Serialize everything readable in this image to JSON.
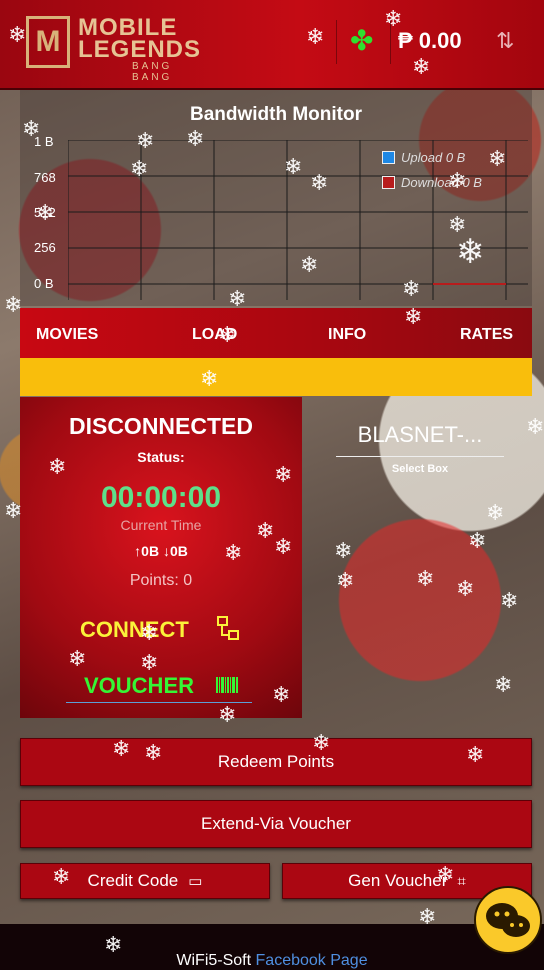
{
  "header": {
    "logo_mark": "M",
    "logo_line1": "MOBILE",
    "logo_line2": "LEGENDS",
    "logo_line3": "BANG BANG",
    "clover_icon": "clover-icon",
    "balance": "₱ 0.00",
    "sort_icon": "sort-icon"
  },
  "monitor": {
    "title": "Bandwidth Monitor",
    "y_ticks": [
      "1 B",
      "768",
      "512",
      "256",
      "0 B"
    ],
    "legend": [
      {
        "label": "Upload",
        "value": "0 B",
        "color": "#1e88e5"
      },
      {
        "label": "Download",
        "value": "0 B",
        "color": "#b71c1c"
      }
    ]
  },
  "nav": {
    "items": [
      "MOVIES",
      "LOAD",
      "INFO",
      "RATES"
    ]
  },
  "status": {
    "title": "DISCONNECTED",
    "status_label": "Status:",
    "timer": "00:00:00",
    "time_label": "Current Time",
    "data_usage": "↑0B ↓0B",
    "points": "Points: 0",
    "connect_label": "CONNECT",
    "voucher_label": "VOUCHER"
  },
  "select": {
    "value": "BLASNET-...",
    "label": "Select Box"
  },
  "actions": {
    "redeem": "Redeem Points",
    "extend": "Extend-Via Voucher",
    "credit_code": "Credit Code",
    "gen_voucher": "Gen Voucher"
  },
  "footer": {
    "text": "WiFi5-Soft",
    "link": "Facebook Page"
  },
  "colors": {
    "header_red": "#c40b14",
    "nav_red": "#a70710",
    "accent_yellow": "#f9be0c",
    "timer_green": "#5ee08a",
    "connect_yellow": "#fbf23a",
    "voucher_green": "#35f535",
    "link_blue": "#4f8fe0"
  }
}
